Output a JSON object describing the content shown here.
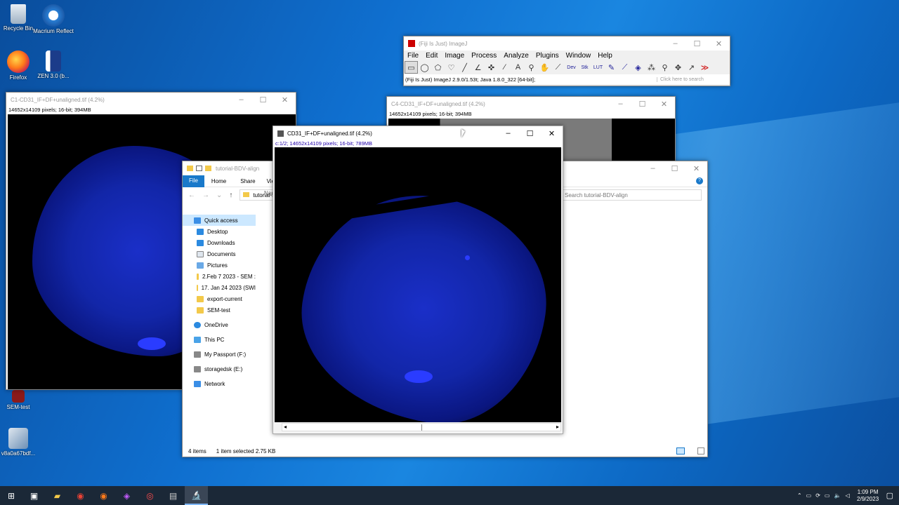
{
  "desktop": {
    "icons": [
      {
        "label": "Recycle Bin"
      },
      {
        "label": "Macrium Reflect"
      },
      {
        "label": "Firefox"
      },
      {
        "label": "ZEN 3.0 (b..."
      },
      {
        "label": "SEM-test"
      },
      {
        "label": "v8a0a67bdf..."
      }
    ]
  },
  "imagej": {
    "title": "(Fiji Is Just) ImageJ",
    "menu": [
      "File",
      "Edit",
      "Image",
      "Process",
      "Analyze",
      "Plugins",
      "Window",
      "Help"
    ],
    "status": "(Fiji Is Just) ImageJ 2.9.0/1.53t; Java 1.8.0_322 [64-bit];",
    "search_placeholder": "Click here to search",
    "tools": [
      "rectangle-tool",
      "oval-tool",
      "polygon-tool",
      "freehand-tool",
      "line-tool",
      "angle-tool",
      "point-tool",
      "wand-tool",
      "text-tool",
      "magnifier-tool",
      "hand-tool",
      "dropper-tool",
      "dev-tool",
      "stk-tool",
      "lut-tool",
      "pencil-tool",
      "brush-tool",
      "flood-fill-tool",
      "spray-tool",
      "zoom-tool",
      "move-tool",
      "pick-tool",
      "more-tools"
    ],
    "tool_labels": {
      "dev": "Dev",
      "stk": "Stk",
      "lut": "LUT"
    }
  },
  "c1_window": {
    "title": "C1-CD31_IF+DF+unaligned.tif (4.2%)",
    "info": "14652x14109 pixels; 16-bit; 394MB"
  },
  "c4_window": {
    "title": "C4-CD31_IF+DF+unaligned.tif (4.2%)",
    "info": "14652x14109 pixels; 16-bit; 394MB"
  },
  "main_window": {
    "title": "CD31_IF+DF+unaligned.tif (4.2%)",
    "info": "c:1/2; 14652x14109 pixels; 16-bit; 789MB"
  },
  "explorer": {
    "title": "tutorial-BDV-align",
    "ribbon_tabs": [
      "File",
      "Home",
      "Share",
      "View"
    ],
    "address": "tutorial-BDV-align",
    "search_placeholder": "Search tutorial-BDV-align",
    "column_name": "Name",
    "nav": [
      {
        "label": "Quick access",
        "icon": "star"
      },
      {
        "label": "Desktop",
        "icon": "desktop"
      },
      {
        "label": "Downloads",
        "icon": "download"
      },
      {
        "label": "Documents",
        "icon": "doc"
      },
      {
        "label": "Pictures",
        "icon": "pic"
      },
      {
        "label": "2.Feb 7 2023 - SEM :",
        "icon": "folder"
      },
      {
        "label": "17. Jan 24 2023 (SWI",
        "icon": "folder"
      },
      {
        "label": "export-current",
        "icon": "folder"
      },
      {
        "label": "SEM-test",
        "icon": "folder"
      },
      {
        "label": "OneDrive",
        "icon": "cloud"
      },
      {
        "label": "This PC",
        "icon": "pc"
      },
      {
        "label": "My Passport (F:)",
        "icon": "drive"
      },
      {
        "label": "storagedsk (E:)",
        "icon": "drive"
      },
      {
        "label": "Network",
        "icon": "network"
      }
    ],
    "status_items": "4 items",
    "status_selected": "1 item selected  2.75 KB"
  },
  "taskbar": {
    "time": "1:09 PM",
    "date": "2/9/2023"
  },
  "colors": {
    "accent": "#0078d7",
    "taskbar": "#1b2837",
    "fiji_blue": "#1226a8"
  }
}
